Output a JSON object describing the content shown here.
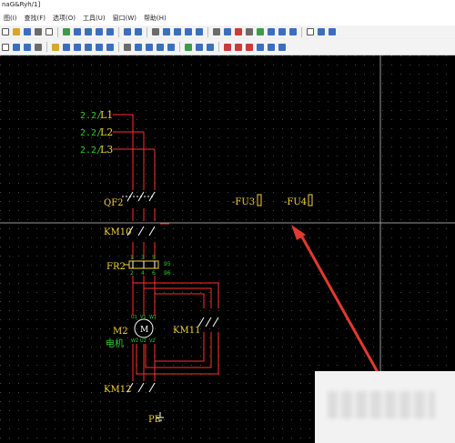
{
  "window": {
    "title": "naG&Ryh/1]"
  },
  "menu": {
    "items": [
      "图(I)",
      "查找(F)",
      "选项(O)",
      "工具(U)",
      "窗口(W)",
      "帮助(H)"
    ]
  },
  "schematic": {
    "phase_lines": [
      {
        "prefix": "2.2/",
        "name": "L1"
      },
      {
        "prefix": "2.2/",
        "name": "L2"
      },
      {
        "prefix": "2.2/",
        "name": "L3"
      }
    ],
    "components": {
      "breaker": "QF2",
      "contactor_1": "KM10",
      "overload_relay": "FR2",
      "motor": "M2",
      "motor_desc": "电机",
      "motor_symbol": "M",
      "contactor_2": "KM11",
      "contactor_3": "KM12",
      "earth": "PE",
      "fuse_1": "-FU3",
      "fuse_2": "-FU4"
    },
    "terminals": {
      "fr_aux": [
        "95",
        "96"
      ],
      "fr_pins": [
        "1",
        "3",
        "5",
        "2",
        "4",
        "6"
      ],
      "motor_pins": [
        "U1",
        "V1",
        "W1",
        "W2",
        "U2",
        "V2"
      ]
    }
  },
  "colors": {
    "canvas": "#000000",
    "wire": "#ff2e2e",
    "label_green": "#2bd12b",
    "label_yellow": "#f2d33a",
    "annotation_arrow": "#e23a2e"
  }
}
